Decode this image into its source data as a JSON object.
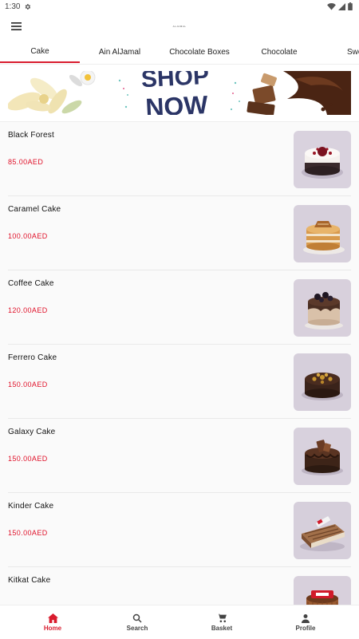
{
  "status_bar": {
    "time": "1:30"
  },
  "header": {
    "logo_text": "ALJAMAL"
  },
  "tabs": [
    {
      "label": "Cake",
      "active": true
    },
    {
      "label": "Ain AlJamal",
      "active": false
    },
    {
      "label": "Chocolate Boxes",
      "active": false
    },
    {
      "label": "Chocolate",
      "active": false
    },
    {
      "label": "Swe",
      "active": false
    }
  ],
  "banner": {
    "text_line1": "SHOP",
    "text_line2": "NOW"
  },
  "products": [
    {
      "name": "Black Forest",
      "price": "85.00AED"
    },
    {
      "name": "Caramel Cake",
      "price": "100.00AED"
    },
    {
      "name": "Coffee Cake",
      "price": "120.00AED"
    },
    {
      "name": "Ferrero Cake",
      "price": "150.00AED"
    },
    {
      "name": "Galaxy Cake",
      "price": "150.00AED"
    },
    {
      "name": "Kinder Cake",
      "price": "150.00AED"
    },
    {
      "name": "Kitkat  Cake",
      "price": ""
    }
  ],
  "bottom_nav": [
    {
      "label": "Home",
      "icon": "home-icon",
      "active": true
    },
    {
      "label": "Search",
      "icon": "search-icon",
      "active": false
    },
    {
      "label": "Basket",
      "icon": "basket-icon",
      "active": false
    },
    {
      "label": "Profile",
      "icon": "profile-icon",
      "active": false
    }
  ],
  "colors": {
    "accent": "#d91c2e",
    "price": "#e0122a",
    "banner_text": "#2b3566"
  }
}
